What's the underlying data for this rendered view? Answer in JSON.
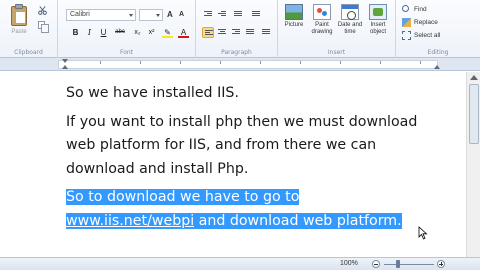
{
  "ribbon": {
    "clipboard": {
      "label": "Clipboard",
      "paste_label": "Paste"
    },
    "font": {
      "label": "Font",
      "font_name": "Calibri",
      "font_size": "",
      "grow_label": "A",
      "shrink_label": "A",
      "bold_label": "B",
      "italic_label": "I",
      "underline_label": "U",
      "strike_label": "abc",
      "subscript_label": "x₂",
      "superscript_label": "x²",
      "highlight_label": "✎",
      "color_label": "A"
    },
    "paragraph": {
      "label": "Paragraph"
    },
    "insert": {
      "label": "Insert",
      "picture_label": "Picture",
      "paint_label": "Paint drawing",
      "date_label": "Date and time",
      "object_label": "Insert object"
    },
    "editing": {
      "label": "Editing",
      "find_label": "Find",
      "replace_label": "Replace",
      "select_all_label": "Select all"
    }
  },
  "document": {
    "p1": "So we have installed IIS.",
    "p2": "If you want to install php then we must download web platform for IIS, and from there we can download and install Php.",
    "p3_line1": "So to download we have to go to",
    "p3_link": "www.iis.net/webpi",
    "p3_rest": " and download web platform."
  },
  "statusbar": {
    "zoom": "100%"
  },
  "colors": {
    "selection": "#3399ff",
    "ribbon_bg": "#eef3fa",
    "active_align": "#fbd985"
  },
  "icons": [
    "paste-icon",
    "scissors-icon",
    "copy-icon",
    "highlight-icon",
    "font-color-icon",
    "picture-icon",
    "paint-icon",
    "date-time-icon",
    "insert-object-icon",
    "find-icon",
    "replace-icon",
    "select-all-icon",
    "mouse-cursor-icon"
  ]
}
